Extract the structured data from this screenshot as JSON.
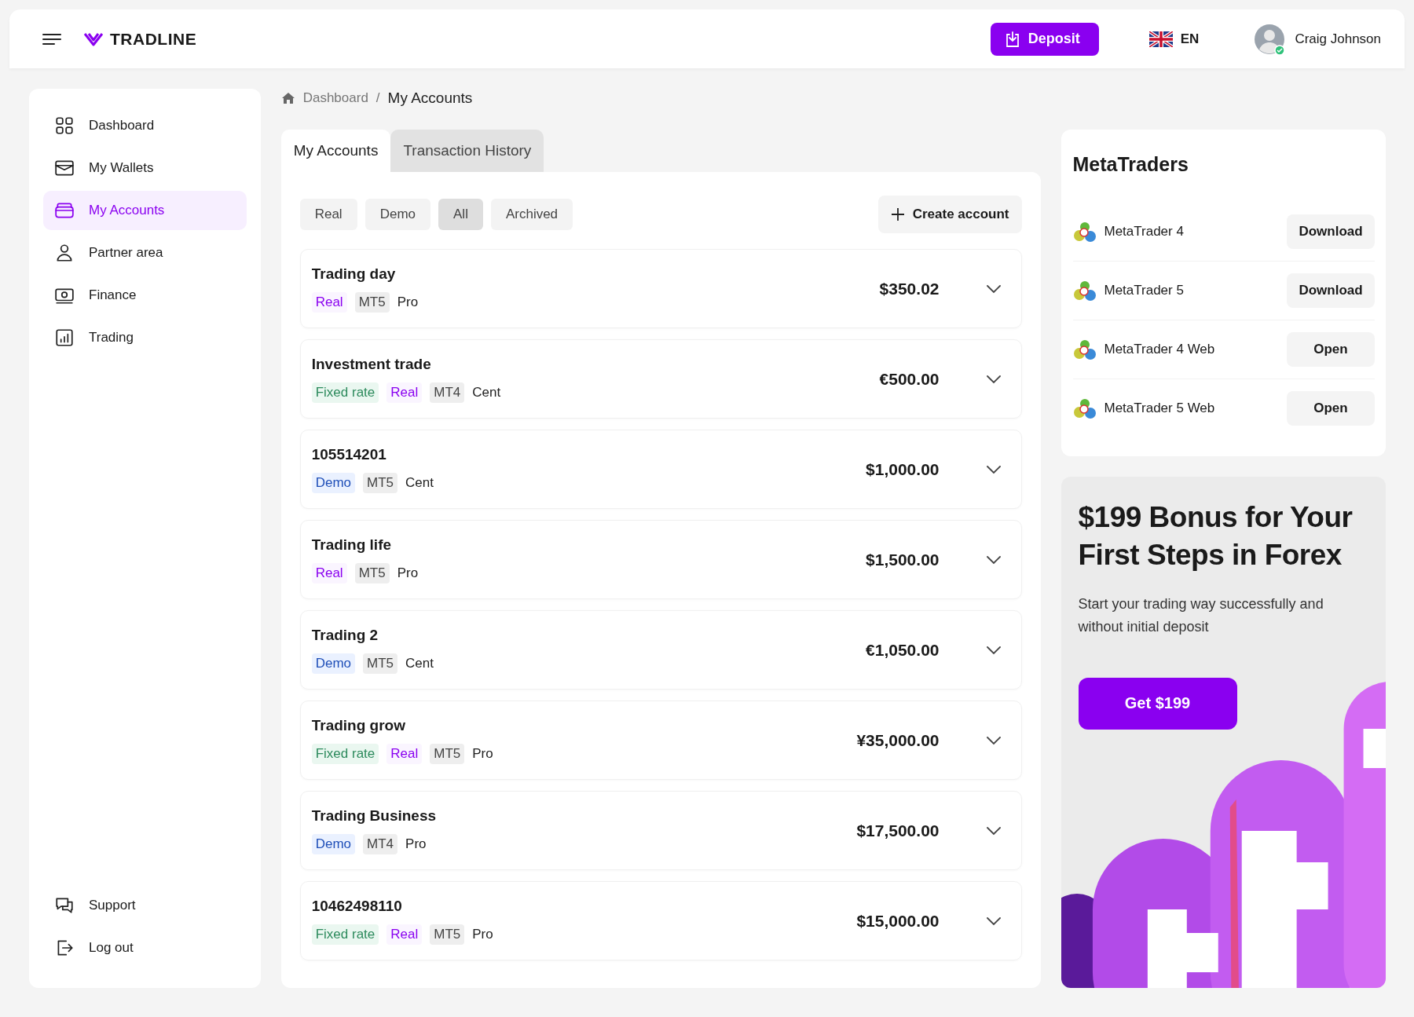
{
  "header": {
    "brand": "TRADLINE",
    "deposit_button": "Deposit",
    "language": "EN",
    "user_name": "Craig Johnson"
  },
  "sidebar": {
    "items": [
      {
        "label": "Dashboard",
        "selected": false
      },
      {
        "label": "My Wallets",
        "selected": false
      },
      {
        "label": "My Accounts",
        "selected": true
      },
      {
        "label": "Partner area",
        "selected": false
      },
      {
        "label": "Finance",
        "selected": false
      },
      {
        "label": "Trading",
        "selected": false
      }
    ],
    "bottom_items": [
      {
        "label": "Support"
      },
      {
        "label": "Log out"
      }
    ]
  },
  "breadcrumb": {
    "parent": "Dashboard",
    "separator": "/",
    "current": "My Accounts"
  },
  "tabs": [
    {
      "label": "My Accounts",
      "selected": true
    },
    {
      "label": "Transaction History",
      "selected": false
    }
  ],
  "filters": [
    {
      "label": "Real",
      "selected": false
    },
    {
      "label": "Demo",
      "selected": false
    },
    {
      "label": "All",
      "selected": true
    },
    {
      "label": "Archived",
      "selected": false
    }
  ],
  "create_button": "Create account",
  "accounts": [
    {
      "name": "Trading day",
      "amount": "$350.02",
      "tags": [
        {
          "kind": "real",
          "text": "Real"
        },
        {
          "kind": "platform",
          "text": "MT5"
        },
        {
          "kind": "type",
          "text": "Pro"
        }
      ]
    },
    {
      "name": "Investment trade",
      "amount": "€500.00",
      "tags": [
        {
          "kind": "fixed",
          "text": "Fixed rate"
        },
        {
          "kind": "real",
          "text": "Real"
        },
        {
          "kind": "platform",
          "text": "MT4"
        },
        {
          "kind": "type",
          "text": "Cent"
        }
      ]
    },
    {
      "name": "105514201",
      "amount": "$1,000.00",
      "tags": [
        {
          "kind": "demo",
          "text": "Demo"
        },
        {
          "kind": "platform",
          "text": "MT5"
        },
        {
          "kind": "type",
          "text": "Cent"
        }
      ]
    },
    {
      "name": "Trading life",
      "amount": "$1,500.00",
      "tags": [
        {
          "kind": "real",
          "text": "Real"
        },
        {
          "kind": "platform",
          "text": "MT5"
        },
        {
          "kind": "type",
          "text": "Pro"
        }
      ]
    },
    {
      "name": "Trading 2",
      "amount": "€1,050.00",
      "tags": [
        {
          "kind": "demo",
          "text": "Demo"
        },
        {
          "kind": "platform",
          "text": "MT5"
        },
        {
          "kind": "type",
          "text": "Cent"
        }
      ]
    },
    {
      "name": "Trading grow",
      "amount": "¥35,000.00",
      "tags": [
        {
          "kind": "fixed",
          "text": "Fixed rate"
        },
        {
          "kind": "real",
          "text": "Real"
        },
        {
          "kind": "platform",
          "text": "MT5"
        },
        {
          "kind": "type",
          "text": "Pro"
        }
      ]
    },
    {
      "name": "Trading Business",
      "amount": "$17,500.00",
      "tags": [
        {
          "kind": "demo",
          "text": "Demo"
        },
        {
          "kind": "platform",
          "text": "MT4"
        },
        {
          "kind": "type",
          "text": "Pro"
        }
      ]
    },
    {
      "name": "10462498110",
      "amount": "$15,000.00",
      "tags": [
        {
          "kind": "fixed",
          "text": "Fixed rate"
        },
        {
          "kind": "real",
          "text": "Real"
        },
        {
          "kind": "platform",
          "text": "MT5"
        },
        {
          "kind": "type",
          "text": "Pro"
        }
      ]
    }
  ],
  "metatraders": {
    "title": "MetaTraders",
    "items": [
      {
        "name": "MetaTrader 4",
        "action": "Download"
      },
      {
        "name": "MetaTrader 5",
        "action": "Download"
      },
      {
        "name": "MetaTrader 4 Web",
        "action": "Open"
      },
      {
        "name": "MetaTrader 5 Web",
        "action": "Open"
      }
    ]
  },
  "promo": {
    "title": "$199 Bonus for Your First Steps in Forex",
    "text": "Start your trading way successfully and without initial deposit",
    "button": "Get $199"
  }
}
